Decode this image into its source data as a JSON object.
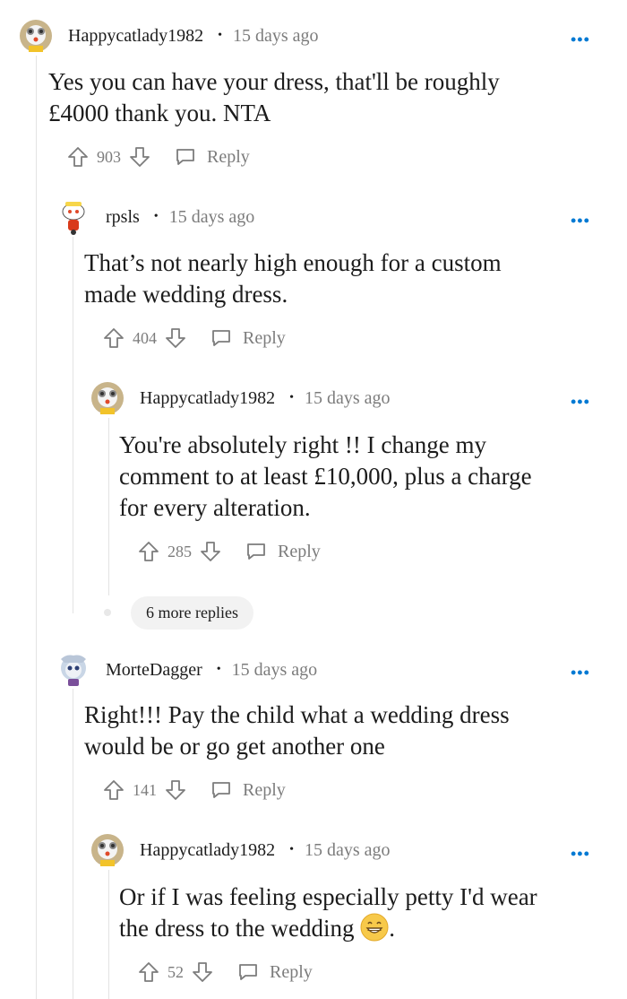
{
  "comments": [
    {
      "author": "Happycatlady1982",
      "time": "15 days ago",
      "more_label": "•••",
      "text_lines": [
        "Yes you can have your dress, that'll be roughly",
        "£4000 thank you. NTA"
      ],
      "score": "903",
      "reply_label": "Reply"
    },
    {
      "author": "rpsls",
      "time": "15 days ago",
      "more_label": "•••",
      "text_lines": [
        "That’s not nearly high enough for a custom",
        "made wedding dress."
      ],
      "score": "404",
      "reply_label": "Reply"
    },
    {
      "author": "Happycatlady1982",
      "time": "15 days ago",
      "more_label": "•••",
      "text_lines": [
        "You're absolutely right !! I change my",
        "comment to at least £10,000, plus a charge",
        "for every alteration."
      ],
      "score": "285",
      "reply_label": "Reply"
    },
    {
      "author": "MorteDagger",
      "time": "15 days ago",
      "more_label": "•••",
      "text_lines": [
        "Right!!! Pay the child what a wedding dress",
        "would be or go get another one"
      ],
      "score": "141",
      "reply_label": "Reply"
    },
    {
      "author": "Happycatlady1982",
      "time": "15 days ago",
      "more_label": "•••",
      "text_lines": [
        "Or if I was feeling especially petty I'd wear",
        "the dress to the wedding",
        "."
      ],
      "score": "52",
      "reply_label": "Reply"
    }
  ],
  "more_replies_label": "6 more replies",
  "icons": {
    "upvote": "arrow-up-icon",
    "downvote": "arrow-down-icon",
    "reply": "speech-bubble-icon",
    "emoji": "grinning-face-icon"
  },
  "colors": {
    "accent": "#0079d3",
    "text": "#1c1c1c",
    "muted": "#7c7c7c",
    "thread_line": "#e3e3e3",
    "pill_bg": "#f2f2f2"
  }
}
